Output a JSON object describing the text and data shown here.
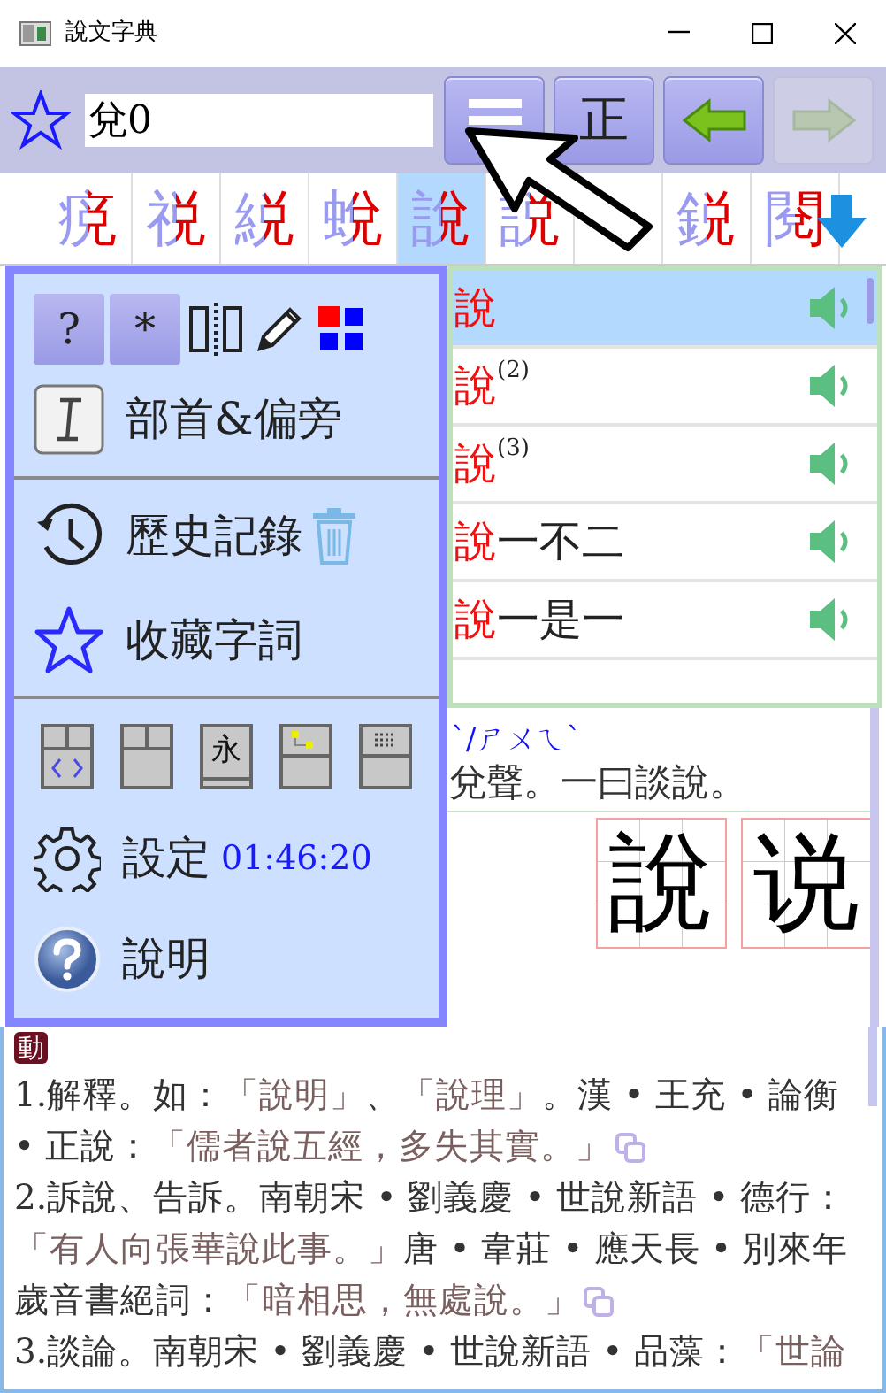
{
  "window": {
    "title": "說文字典"
  },
  "toolbar": {
    "search": {
      "value": "兌0"
    },
    "buttons": [
      {
        "kind": "menu",
        "disabled": false
      },
      {
        "kind": "text",
        "label": "正",
        "disabled": false
      },
      {
        "kind": "back",
        "disabled": false
      },
      {
        "kind": "forward",
        "disabled": true
      }
    ]
  },
  "char_strip": [
    {
      "char": "痥",
      "selected": false
    },
    {
      "char": "祱",
      "selected": false
    },
    {
      "char": "綐",
      "selected": false
    },
    {
      "char": "蛻",
      "selected": false
    },
    {
      "char": "說",
      "selected": true
    },
    {
      "char": "説",
      "selected": false
    },
    {
      "selected": false
    },
    {
      "char": "鋭",
      "selected": false
    },
    {
      "char": "閱",
      "selected": false
    }
  ],
  "results": [
    {
      "head": "說",
      "selected": true
    },
    {
      "head": "說",
      "index": "(2)",
      "selected": false
    },
    {
      "head": "說",
      "index": "(3)",
      "selected": false
    },
    {
      "head": "說",
      "rest": "一不二",
      "selected": false
    },
    {
      "head": "說",
      "rest": "一是一",
      "selected": false
    }
  ],
  "menu": {
    "tools": [
      {
        "kind": "text",
        "label": "?",
        "selected": true
      },
      {
        "kind": "text",
        "label": "*",
        "selected": true
      },
      {
        "kind": "split",
        "selected": false
      },
      {
        "kind": "pencil",
        "selected": false
      },
      {
        "kind": "colors",
        "selected": false
      }
    ],
    "items": [
      {
        "kind": "radicals",
        "label": "部首&偏旁"
      },
      {
        "kind": "divider"
      },
      {
        "kind": "history",
        "label": "歷史記錄"
      },
      {
        "kind": "favorites",
        "label": "收藏字詞"
      },
      {
        "kind": "divider"
      },
      {
        "kind": "layouts",
        "layouts": [
          {
            "kind": "code"
          },
          {
            "kind": "plain"
          },
          {
            "kind": "char",
            "label": "永"
          },
          {
            "kind": "tree"
          },
          {
            "kind": "grid"
          }
        ]
      },
      {
        "kind": "settings",
        "label": "設定",
        "time": "01:46:20"
      },
      {
        "kind": "help",
        "label": "說明"
      }
    ]
  },
  "entry": {
    "phonetic": "ˋ/ㄕㄨㄟˋ",
    "explanation": "兌聲。一曰談說。",
    "glyphs": [
      "說",
      "说"
    ],
    "part_of_speech": "動",
    "definitions": [
      {
        "copy": true,
        "segments": [
          {
            "kind": "plain",
            "text": "1.解釋。如："
          },
          {
            "kind": "quote",
            "text": "「說明」"
          },
          {
            "kind": "plain",
            "text": "、"
          },
          {
            "kind": "quote",
            "text": "「說理」"
          },
          {
            "kind": "plain",
            "text": "。漢 • 王充 • 論衡 • 正說："
          },
          {
            "kind": "quote",
            "text": "「儒者說五經，多失其實。」"
          }
        ]
      },
      {
        "copy": true,
        "segments": [
          {
            "kind": "plain",
            "text": "2.訴說、告訴。南朝宋 • 劉義慶 • 世說新語 • 德行："
          },
          {
            "kind": "quote",
            "text": "「有人向張華說此事。」"
          },
          {
            "kind": "plain",
            "text": "唐 • 韋莊 • 應天長 • 別來年歲音書絕詞："
          },
          {
            "kind": "quote",
            "text": "「暗相思，無處說。」"
          }
        ]
      },
      {
        "copy": false,
        "segments": [
          {
            "kind": "plain",
            "text": "3.談論。南朝宋 • 劉義慶 • 世說新語 • 品藻："
          },
          {
            "kind": "quote",
            "text": "「世論"
          }
        ]
      }
    ]
  }
}
